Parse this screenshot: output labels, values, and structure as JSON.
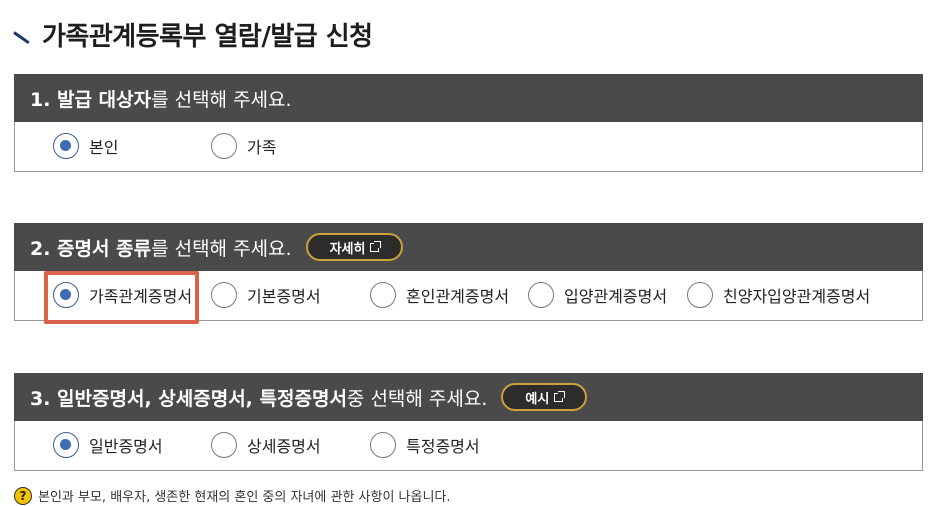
{
  "page": {
    "title": "가족관계등록부 열람/발급 신청"
  },
  "section1": {
    "heading_bold": "1. 발급 대상자",
    "heading_rest": "를 선택해 주세요.",
    "options": [
      {
        "label": "본인",
        "selected": true
      },
      {
        "label": "가족",
        "selected": false
      }
    ]
  },
  "section2": {
    "heading_bold": "2. 증명서 종류",
    "heading_rest": "를 선택해 주세요.",
    "detail_button": "자세히",
    "options": [
      {
        "label": "가족관계증명서",
        "selected": true
      },
      {
        "label": "기본증명서",
        "selected": false
      },
      {
        "label": "혼인관계증명서",
        "selected": false
      },
      {
        "label": "입양관계증명서",
        "selected": false
      },
      {
        "label": "친양자입양관계증명서",
        "selected": false
      }
    ]
  },
  "section3": {
    "heading_bold": "3. 일반증명서, 상세증명서, 특정증명서",
    "heading_rest": " 중 선택해 주세요.",
    "example_button": "예시",
    "options": [
      {
        "label": "일반증명서",
        "selected": true
      },
      {
        "label": "상세증명서",
        "selected": false
      },
      {
        "label": "특정증명서",
        "selected": false
      }
    ]
  },
  "note": {
    "icon": "question-icon",
    "text": "본인과 부모, 배우자, 생존한 현재의 혼인 중의 자녀에 관한 사항이 나옵니다."
  },
  "colors": {
    "header_bg": "#4a4a4a",
    "button_border": "#c8a23b",
    "highlight": "#d9634a",
    "radio_fill": "#3e6cb3"
  }
}
